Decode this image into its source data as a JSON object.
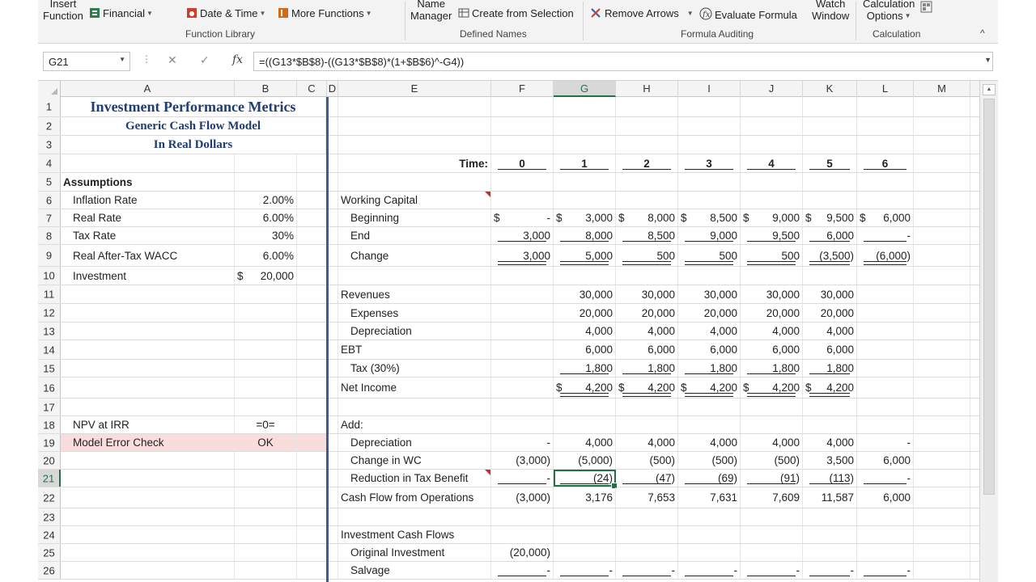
{
  "ribbon": {
    "insert_function": [
      "Insert",
      "Function"
    ],
    "financial": "Financial",
    "date_time": "Date & Time",
    "more_functions": "More Functions",
    "name_manager": [
      "Name",
      "Manager"
    ],
    "create_from_selection": "Create from Selection",
    "remove_arrows": "Remove Arrows",
    "evaluate_formula": "Evaluate Formula",
    "watch_window": [
      "Watch",
      "Window"
    ],
    "calc_options": [
      "Calculation",
      "Options"
    ],
    "groups": {
      "function_library": "Function Library",
      "defined_names": "Defined Names",
      "formula_auditing": "Formula Auditing",
      "calculation": "Calculation"
    }
  },
  "formula_bar": {
    "name_box": "G21",
    "fx": "fx",
    "formula": "=((G13*$B$8)-((G13*$B$8)*(1+$B$6)^-G4))"
  },
  "columns": [
    "A",
    "B",
    "C",
    "D",
    "E",
    "F",
    "G",
    "H",
    "I",
    "J",
    "K",
    "L",
    "M"
  ],
  "rows": [
    {
      "n": "1",
      "a": "Investment Performance Metrics"
    },
    {
      "n": "2",
      "a": "Generic Cash Flow Model"
    },
    {
      "n": "3",
      "a": "In Real Dollars"
    },
    {
      "n": "4",
      "e": "Time:",
      "f": "0",
      "g": "1",
      "h": "2",
      "i": "3",
      "j": "4",
      "k": "5",
      "l": "6"
    },
    {
      "n": "5",
      "a": "Assumptions"
    },
    {
      "n": "6",
      "a": "Inflation Rate",
      "b": "2.00%",
      "e": "Working Capital"
    },
    {
      "n": "7",
      "a": "Real Rate",
      "b": "6.00%",
      "e": "Beginning",
      "f": "-",
      "g": "3,000",
      "h": "8,000",
      "i": "8,500",
      "j": "9,000",
      "k": "9,500",
      "l": "6,000"
    },
    {
      "n": "8",
      "a": "Tax Rate",
      "b": "30%",
      "e": "End",
      "f": "3,000",
      "g": "8,000",
      "h": "8,500",
      "i": "9,000",
      "j": "9,500",
      "k": "6,000",
      "l": "-"
    },
    {
      "n": "9",
      "a": "Real After-Tax WACC",
      "b": "6.00%",
      "e": "Change",
      "f": "3,000",
      "g": "5,000",
      "h": "500",
      "i": "500",
      "j": "500",
      "k": "(3,500)",
      "l": "(6,000)"
    },
    {
      "n": "10",
      "a": "Investment",
      "b": "20,000"
    },
    {
      "n": "11",
      "e": "Revenues",
      "g": "30,000",
      "h": "30,000",
      "i": "30,000",
      "j": "30,000",
      "k": "30,000"
    },
    {
      "n": "12",
      "e": "Expenses",
      "g": "20,000",
      "h": "20,000",
      "i": "20,000",
      "j": "20,000",
      "k": "20,000"
    },
    {
      "n": "13",
      "e": "Depreciation",
      "g": "4,000",
      "h": "4,000",
      "i": "4,000",
      "j": "4,000",
      "k": "4,000"
    },
    {
      "n": "14",
      "e": "EBT",
      "g": "6,000",
      "h": "6,000",
      "i": "6,000",
      "j": "6,000",
      "k": "6,000"
    },
    {
      "n": "15",
      "e": "Tax (30%)",
      "g": "1,800",
      "h": "1,800",
      "i": "1,800",
      "j": "1,800",
      "k": "1,800"
    },
    {
      "n": "16",
      "e": "Net Income",
      "g": "4,200",
      "h": "4,200",
      "i": "4,200",
      "j": "4,200",
      "k": "4,200"
    },
    {
      "n": "17"
    },
    {
      "n": "18",
      "a": "NPV at IRR",
      "b": "=0=",
      "e": "Add:"
    },
    {
      "n": "19",
      "a": "Model Error Check",
      "b": "OK",
      "e": "Depreciation",
      "f": "-",
      "g": "4,000",
      "h": "4,000",
      "i": "4,000",
      "j": "4,000",
      "k": "4,000",
      "l": "-"
    },
    {
      "n": "20",
      "e": "Change in WC",
      "f": "(3,000)",
      "g": "(5,000)",
      "h": "(500)",
      "i": "(500)",
      "j": "(500)",
      "k": "3,500",
      "l": "6,000"
    },
    {
      "n": "21",
      "e": "Reduction in Tax Benefit",
      "f": "-",
      "g": "(24)",
      "h": "(47)",
      "i": "(69)",
      "j": "(91)",
      "k": "(113)",
      "l": "-"
    },
    {
      "n": "22",
      "e": "Cash Flow from Operations",
      "f": "(3,000)",
      "g": "3,176",
      "h": "7,653",
      "i": "7,631",
      "j": "7,609",
      "k": "11,587",
      "l": "6,000"
    },
    {
      "n": "23"
    },
    {
      "n": "24",
      "e": "Investment Cash Flows"
    },
    {
      "n": "25",
      "e": "Original Investment",
      "f": "(20,000)"
    },
    {
      "n": "26",
      "e": "Salvage",
      "f": "-",
      "g": "-",
      "h": "-",
      "i": "-",
      "j": "-",
      "k": "-",
      "l": "-"
    }
  ],
  "currency_symbol": "$",
  "active_cell": {
    "col": "G",
    "row": "21"
  },
  "colors": {
    "title_blue": "#1f3c73",
    "error_check_pink": "#f9dcdc",
    "excel_green": "#217346",
    "divider_blue": "#3d5b8d"
  },
  "icons": [
    "financial-icon",
    "date-time-icon",
    "more-functions-icon",
    "create-from-selection-icon",
    "remove-arrows-icon",
    "evaluate-formula-icon",
    "calc-options-icon",
    "collapse-ribbon-icon"
  ]
}
